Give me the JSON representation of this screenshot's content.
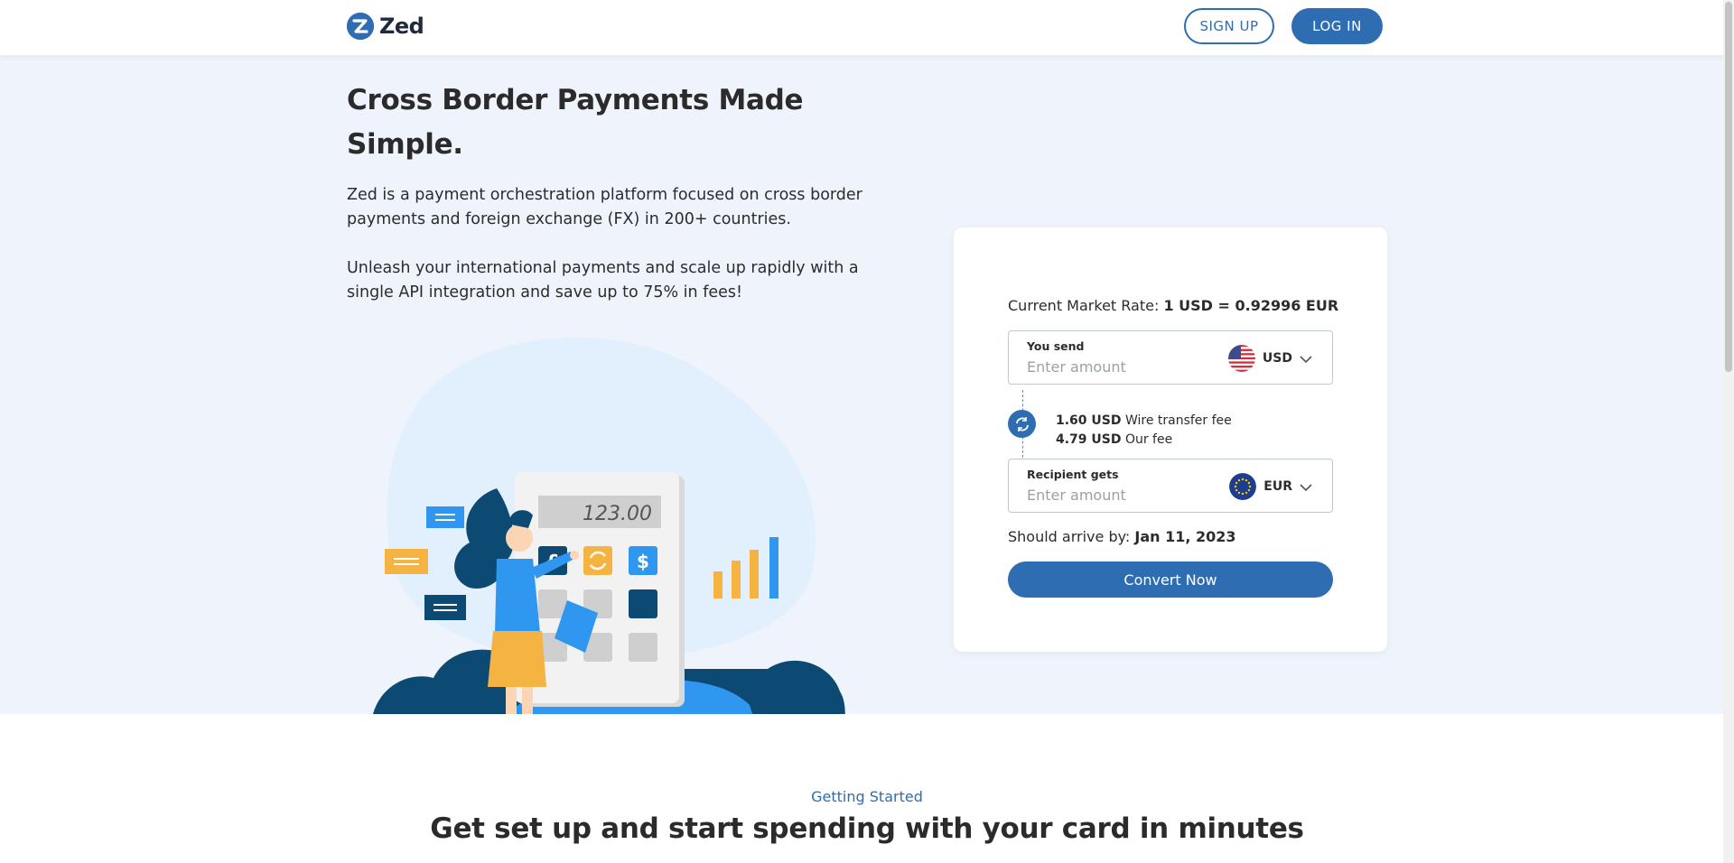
{
  "header": {
    "logo_text": "Zed",
    "signup_label": "SIGN UP",
    "login_label": "LOG IN"
  },
  "hero": {
    "title": "Cross Border Payments Made Simple.",
    "paragraph_1": "Zed is a payment orchestration platform focused on cross border payments and foreign exchange (FX) in 200+ countries.",
    "paragraph_2": "Unleash your international payments and scale up rapidly with a single API integration and save up to 75% in fees!",
    "illustration": {
      "display_value": "123.00",
      "key_labels": [
        "£",
        "$"
      ]
    }
  },
  "converter": {
    "rate_label": "Current Market Rate:",
    "rate_value": "1 USD = 0.92996 EUR",
    "send": {
      "label": "You send",
      "placeholder": "Enter amount",
      "currency": "USD",
      "flag_icon": "us-flag-icon"
    },
    "fees": [
      {
        "amount": "1.60 USD",
        "label": "Wire transfer fee"
      },
      {
        "amount": "4.79 USD",
        "label": "Our fee"
      }
    ],
    "receive": {
      "label": "Recipient gets",
      "placeholder": "Enter amount",
      "currency": "EUR",
      "flag_icon": "eu-flag-icon"
    },
    "arrive_label": "Should arrive by:",
    "arrive_date": "Jan 11, 2023",
    "convert_label": "Convert Now"
  },
  "getting_started": {
    "eyebrow": "Getting Started",
    "title": "Get set up and start spending with your card in minutes"
  },
  "colors": {
    "brand": "#2f6db3",
    "hero_bg": "#eff3fb",
    "illustration_dark": "#0d4a73",
    "illustration_yellow": "#f5b342",
    "illustration_blue": "#3097f0"
  }
}
